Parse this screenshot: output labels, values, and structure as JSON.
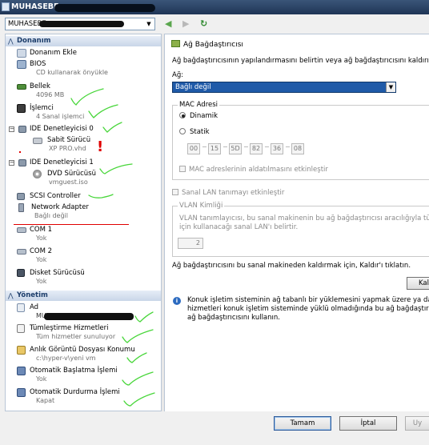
{
  "window": {
    "title": "MUHASEBE"
  },
  "toolbar": {
    "vm_select_value": "MUHASEBE"
  },
  "sections": {
    "hardware": "Donanım",
    "management": "Yönetim"
  },
  "hardware_items": [
    {
      "label": "Donanım Ekle",
      "sub": ""
    },
    {
      "label": "BIOS",
      "sub": "CD kullanarak önyükle"
    },
    {
      "label": "Bellek",
      "sub": "4096 MB"
    },
    {
      "label": "İşlemci",
      "sub": "4 Sanal işlemci"
    },
    {
      "label": "IDE Denetleyicisi 0",
      "sub": ""
    },
    {
      "label": "Sabit Sürücü",
      "sub": "XP PRO.vhd"
    },
    {
      "label": "IDE Denetleyicisi 1",
      "sub": ""
    },
    {
      "label": "DVD Sürücüsü",
      "sub": "vmguest.iso"
    },
    {
      "label": "SCSI Controller",
      "sub": ""
    },
    {
      "label": "Network Adapter",
      "sub": "Bağlı değil"
    },
    {
      "label": "COM 1",
      "sub": "Yok"
    },
    {
      "label": "COM 2",
      "sub": "Yok"
    },
    {
      "label": "Disket Sürücüsü",
      "sub": "Yok"
    }
  ],
  "management_items": [
    {
      "label": "Ad",
      "sub": "MUHASEBE"
    },
    {
      "label": "Tümleştirme Hizmetleri",
      "sub": "Tüm hizmetler sunuluyor"
    },
    {
      "label": "Anlık Görüntü Dosyası Konumu",
      "sub": "c:\\hyper-v\\yeni vm"
    },
    {
      "label": "Otomatik Başlatma İşlemi",
      "sub": "Yok"
    },
    {
      "label": "Otomatik Durdurma İşlemi",
      "sub": "Kapat"
    }
  ],
  "adapter": {
    "title": "Ağ Bağdaştırıcısı",
    "description": "Ağ bağdaştırıcısının yapılandırmasını belirtin veya ağ bağdaştırıcısını kaldırın.",
    "network_label": "Ağ:",
    "network_value": "Bağlı değil",
    "mac_group": "MAC Adresi",
    "mac_dynamic": "Dinamik",
    "mac_static": "Statik",
    "mac_octets": [
      "00",
      "15",
      "5D",
      "82",
      "36",
      "08"
    ],
    "mac_spoof": "MAC adreslerinin aldatılmasını etkinleştir",
    "vlan_enable": "Sanal LAN tanımayı etkinleştir",
    "vlan_group": "VLAN Kimliği",
    "vlan_desc_1": "VLAN tanımlayıcısı, bu sanal makinenin bu ağ bağdaştırıcısı aracılığıyla tüm ağ ile",
    "vlan_desc_2": "için kullanacağı sanal LAN'ı belirtir.",
    "vlan_value": "2",
    "remove_text": "Ağ bağdaştırıcısını bu sanal makineden kaldırmak için, Kaldır'ı tıklatın.",
    "remove_button": "Kal",
    "info_1": "Konuk işletim sisteminin ağ tabanlı bir yüklemesini yapmak üzere ya da tümleş",
    "info_2": "hizmetleri konuk işletim sisteminde yüklü olmadığında bu ağ bağdaştırıcısı yerin",
    "info_3": "ağ bağdaştırıcısını kullanın."
  },
  "buttons": {
    "ok": "Tamam",
    "cancel": "İptal",
    "apply": "Uy"
  }
}
